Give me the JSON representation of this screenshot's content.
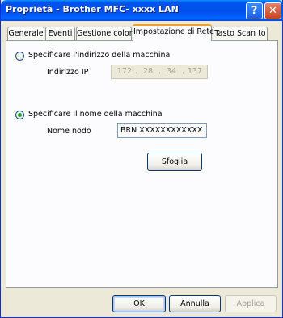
{
  "window": {
    "title": "Proprietà - Brother MFC- xxxx LAN",
    "help_label": "?",
    "close_label": "✕"
  },
  "tabs": [
    {
      "label": "Generale"
    },
    {
      "label": "Eventi"
    },
    {
      "label": "Gestione colori"
    },
    {
      "label": "Impostazione di Rete"
    },
    {
      "label": "Tasto Scan to"
    }
  ],
  "active_tab": "Impostazione di Rete",
  "network": {
    "option_ip_label": "Specificare l'indirizzo della macchina",
    "option_ip_selected": false,
    "ip_label": "Indirizzo IP",
    "ip_parts": [
      "172",
      "28",
      "34",
      "137"
    ],
    "ip_separator": ".",
    "option_name_label": "Specificare il nome della macchina",
    "option_name_selected": true,
    "node_label": "Nome nodo",
    "node_value": "BRN XXXXXXXXXXXX",
    "browse_label": "Sfoglia"
  },
  "footer": {
    "ok_label": "OK",
    "cancel_label": "Annulla",
    "apply_label": "Applica"
  },
  "colors": {
    "titlebar": "#0053ee",
    "window_bg": "#ece9d8",
    "radio_selected": "#21a121"
  }
}
